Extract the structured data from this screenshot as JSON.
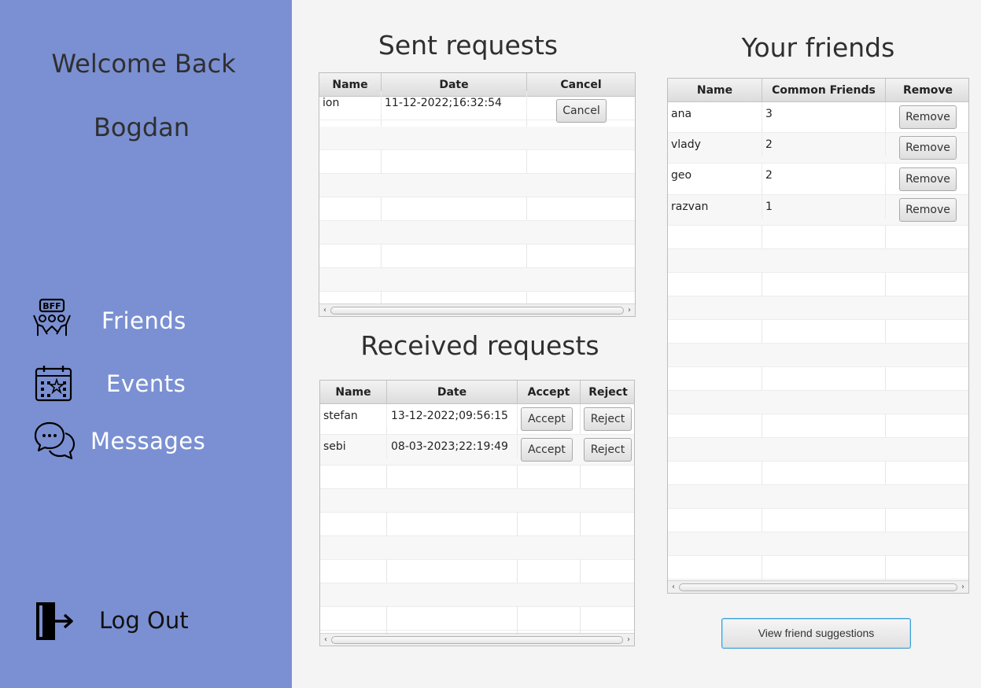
{
  "sidebar": {
    "welcome": "Welcome Back",
    "username": "Bogdan",
    "nav": [
      {
        "label": "Friends",
        "icon": "bff-friends-icon"
      },
      {
        "label": "Events",
        "icon": "calendar-icon"
      },
      {
        "label": "Messages",
        "icon": "chat-bubbles-icon"
      }
    ],
    "logout": {
      "label": "Log Out",
      "icon": "logout-door-icon"
    },
    "bg_color": "#7b90d2"
  },
  "sent": {
    "title": "Sent requests",
    "columns": [
      "Name",
      "Date",
      "Cancel"
    ],
    "rows": [
      {
        "name": "ion",
        "date": "11-12-2022;16:32:54",
        "action": "Cancel"
      }
    ]
  },
  "received": {
    "title": "Received requests",
    "columns": [
      "Name",
      "Date",
      "Accept",
      "Reject"
    ],
    "rows": [
      {
        "name": "stefan",
        "date": "13-12-2022;09:56:15",
        "accept": "Accept",
        "reject": "Reject"
      },
      {
        "name": "sebi",
        "date": "08-03-2023;22:19:49",
        "accept": "Accept",
        "reject": "Reject"
      }
    ]
  },
  "friends": {
    "title": "Your friends",
    "columns": [
      "Name",
      "Common Friends",
      "Remove"
    ],
    "rows": [
      {
        "name": "ana",
        "common": "3",
        "action": "Remove"
      },
      {
        "name": "vlady",
        "common": "2",
        "action": "Remove"
      },
      {
        "name": "geo",
        "common": "2",
        "action": "Remove"
      },
      {
        "name": "razvan",
        "common": "1",
        "action": "Remove"
      }
    ]
  },
  "suggestions_button": "View friend suggestions"
}
